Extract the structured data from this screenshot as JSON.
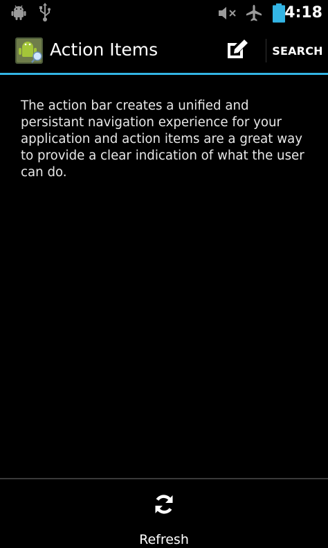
{
  "status_bar": {
    "time": "4:18",
    "icons": [
      "android-debug-icon",
      "usb-icon",
      "volume-muted-icon",
      "airplane-mode-icon",
      "battery-icon"
    ],
    "battery_color": "#33b5e5"
  },
  "action_bar": {
    "title": "Action Items",
    "compose_icon": "compose-icon",
    "search_label": "SEARCH",
    "divider_color": "#33b5e5"
  },
  "content": {
    "text": "The action bar creates a unified and persistant navigation experience for your application and action items are a great way to provide a clear indication of what the user can do."
  },
  "split_action_bar": {
    "refresh_label": "Refresh",
    "refresh_icon": "refresh-icon"
  }
}
